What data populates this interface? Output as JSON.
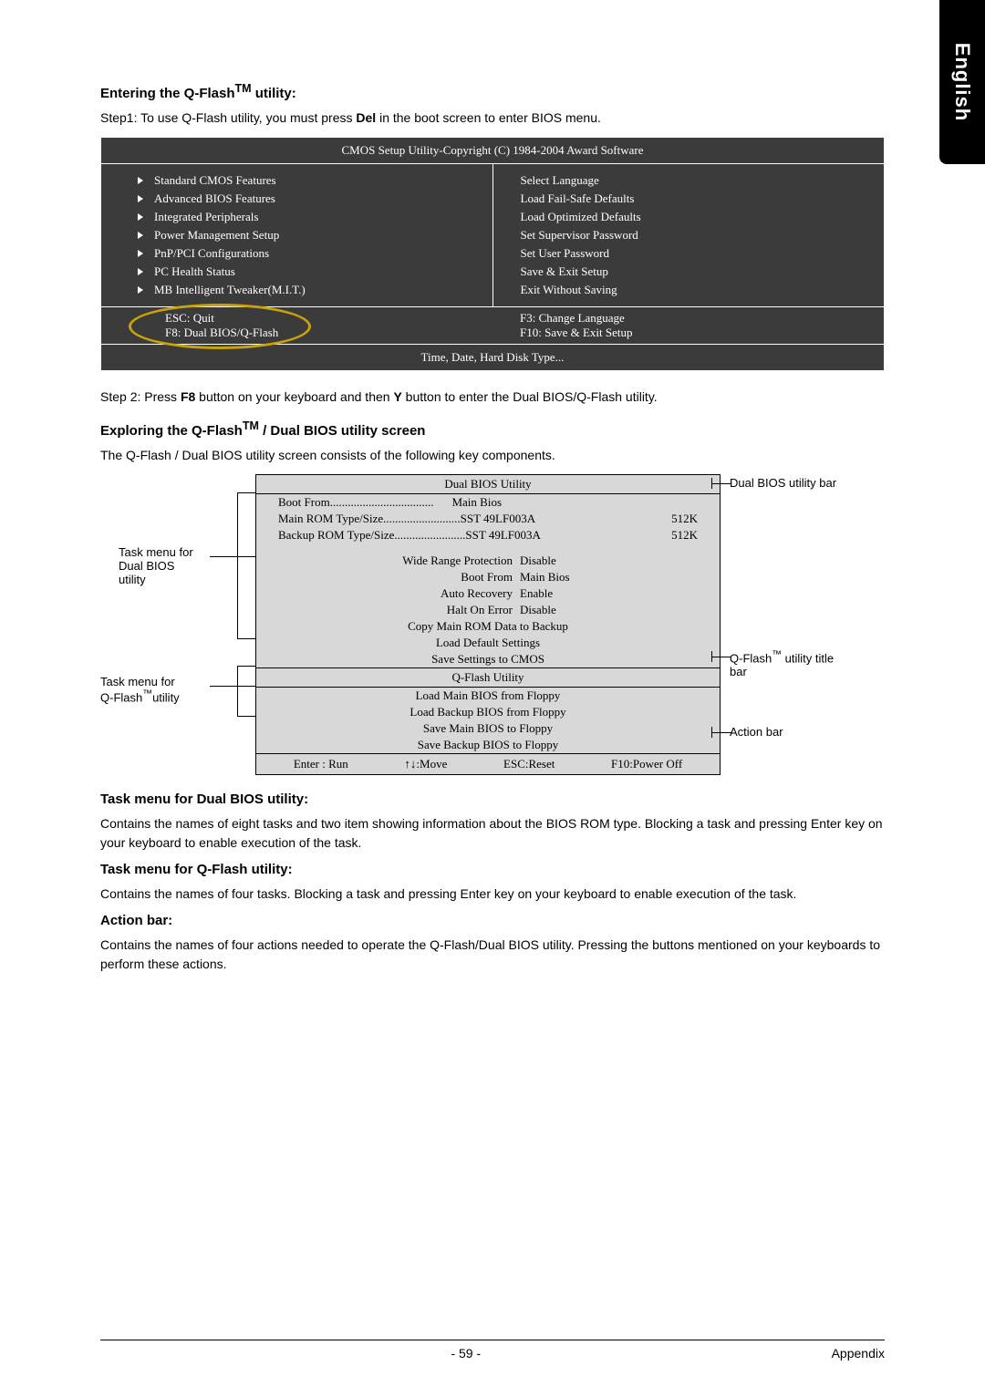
{
  "sideTab": "English",
  "heading1_pre": "Entering the Q-Flash",
  "heading1_post": " utility:",
  "step1_pre": "Step1: To use Q-Flash utility, you must press ",
  "step1_bold": "Del",
  "step1_post": " in the boot screen to enter BIOS menu.",
  "bios": {
    "header": "CMOS Setup Utility-Copyright (C) 1984-2004 Award Software",
    "left": [
      "Standard CMOS Features",
      "Advanced BIOS Features",
      "Integrated Peripherals",
      "Power Management Setup",
      "PnP/PCI Configurations",
      "PC Health Status",
      "MB Intelligent Tweaker(M.I.T.)"
    ],
    "right": [
      "Select Language",
      "Load Fail-Safe Defaults",
      "Load Optimized Defaults",
      "Set Supervisor Password",
      "Set User Password",
      "Save & Exit Setup",
      "Exit Without Saving"
    ],
    "foot_l1": "ESC: Quit",
    "foot_l2": "F8: Dual BIOS/Q-Flash",
    "foot_r1": "F3: Change Language",
    "foot_r2": "F10: Save & Exit Setup",
    "status": "Time, Date, Hard Disk Type..."
  },
  "step2_pre": "Step 2: Press ",
  "step2_b1": "F8",
  "step2_mid": " button on your keyboard and then ",
  "step2_b2": "Y",
  "step2_post": " button to enter the Dual BIOS/Q-Flash utility.",
  "heading2_pre": "Exploring the Q-Flash",
  "heading2_post": " / Dual BIOS utility screen",
  "exploreText": "The Q-Flash / Dual BIOS utility screen consists of the following key components.",
  "utility": {
    "title1": "Dual BIOS Utility",
    "bootfrom_label": "Boot From",
    "bootfrom_val": "Main Bios",
    "rom1_label": "Main ROM Type/Size",
    "rom1_val": "SST 49LF003A",
    "rom1_size": "512K",
    "rom2_label": "Backup ROM Type/Size",
    "rom2_val": "SST 49LF003A",
    "rom2_size": "512K",
    "opts": [
      {
        "label": "Wide Range Protection",
        "val": "Disable"
      },
      {
        "label": "Boot From",
        "val": "Main Bios"
      },
      {
        "label": "Auto Recovery",
        "val": "Enable"
      },
      {
        "label": "Halt On Error",
        "val": "Disable"
      },
      {
        "label": "Copy Main ROM Data to Backup",
        "val": ""
      },
      {
        "label": "Load Default Settings",
        "val": ""
      },
      {
        "label": "Save Settings to CMOS",
        "val": ""
      }
    ],
    "title2": "Q-Flash Utility",
    "qopts": [
      "Load Main BIOS from Floppy",
      "Load Backup BIOS from Floppy",
      "Save Main BIOS to Floppy",
      "Save Backup BIOS to Floppy"
    ],
    "action": {
      "a1": "Enter : Run",
      "a2": "↑↓:Move",
      "a3": "ESC:Reset",
      "a4": "F10:Power Off"
    }
  },
  "callouts": {
    "leftTop1": "Task menu for",
    "leftTop2": "Dual BIOS",
    "leftTop3": "utility",
    "leftBot1": "Task menu for",
    "leftBot2_pre": "Q-Flash",
    "leftBot2_post": "utility",
    "rightTop": "Dual BIOS utility bar",
    "rightMid_pre": "Q-Flash",
    "rightMid_post": " utility title",
    "rightMid2": "bar",
    "rightBot": "Action bar"
  },
  "body": {
    "h3": "Task menu for Dual BIOS utility:",
    "p3": "Contains the names of eight tasks and two item showing information about the BIOS ROM type. Blocking a task and pressing Enter key on your keyboard to enable execution of the task.",
    "h4": "Task menu for Q-Flash utility:",
    "p4": "Contains the names of four tasks. Blocking a task and pressing Enter key on your keyboard to enable execution of the task.",
    "h5": "Action bar:",
    "p5": "Contains the names of four actions needed to operate the Q-Flash/Dual BIOS utility. Pressing the buttons mentioned on your keyboards to perform these actions."
  },
  "footer": {
    "page": "- 59 -",
    "section": "Appendix"
  },
  "tm": "TM",
  "tm2": "™"
}
